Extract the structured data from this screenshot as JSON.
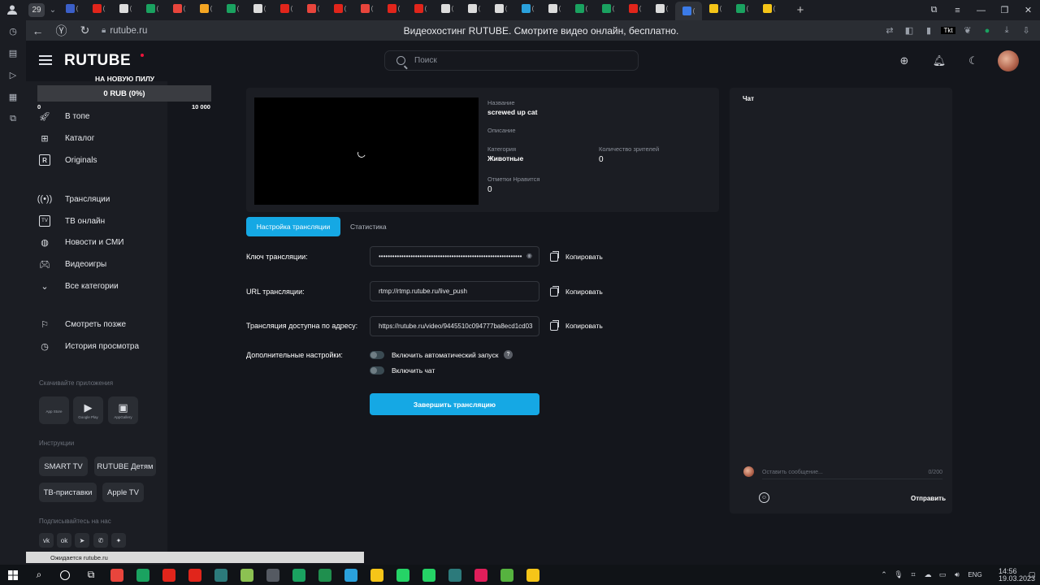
{
  "browser": {
    "tab_count": "29",
    "url": "rutube.ru",
    "page_title": "Видеохостинг RUTUBE. Смотрите видео онлайн, бесплатно.",
    "tabs": [
      {
        "color": "#3b5fc8"
      },
      {
        "color": "#e1251b"
      },
      {
        "color": "#dcdcdc"
      },
      {
        "color": "#1aa260"
      },
      {
        "color": "#e8453c"
      },
      {
        "color": "#f5a623"
      },
      {
        "color": "#1aa260"
      },
      {
        "color": "#dcdcdc"
      },
      {
        "color": "#e1251b"
      },
      {
        "color": "#e8453c"
      },
      {
        "color": "#e1251b"
      },
      {
        "color": "#e8453c"
      },
      {
        "color": "#e1251b"
      },
      {
        "color": "#e1251b"
      },
      {
        "color": "#dcdcdc"
      },
      {
        "color": "#dcdcdc"
      },
      {
        "color": "#dcdcdc"
      },
      {
        "color": "#2aa1dc"
      },
      {
        "color": "#dcdcdc"
      },
      {
        "color": "#1aa260"
      },
      {
        "color": "#1aa260"
      },
      {
        "color": "#e1251b"
      },
      {
        "color": "#dcdcdc"
      },
      {
        "color": "#3b7be8"
      },
      {
        "color": "#f5c518"
      },
      {
        "color": "#1aa260"
      },
      {
        "color": "#f5c518"
      }
    ],
    "status_text": "Ожидается rutube.ru"
  },
  "header": {
    "logo": "RUTUBE",
    "search_placeholder": "Поиск"
  },
  "donation": {
    "title": "НА НОВУЮ ПИЛУ",
    "progress_text": "0 RUB (0%)",
    "progress_fraction": 0,
    "min": "0",
    "max": "10 000"
  },
  "nav": {
    "main": [
      {
        "label": "В топе",
        "icon": "rocket-icon"
      },
      {
        "label": "Каталог",
        "icon": "grid-icon"
      },
      {
        "label": "Originals",
        "icon": "originals-icon"
      }
    ],
    "secondary": [
      {
        "label": "Трансляции",
        "icon": "broadcast-icon"
      },
      {
        "label": "ТВ онлайн",
        "icon": "tv-icon"
      },
      {
        "label": "Новости и СМИ",
        "icon": "globe-icon"
      },
      {
        "label": "Видеоигры",
        "icon": "gamepad-icon"
      },
      {
        "label": "Все категории",
        "icon": "chevron-down-icon"
      }
    ],
    "library": [
      {
        "label": "Смотреть позже",
        "icon": "bookmark-icon"
      },
      {
        "label": "История просмотра",
        "icon": "history-icon"
      }
    ]
  },
  "download": {
    "heading": "Скачивайте приложения",
    "apps": [
      {
        "label": "App Store",
        "icon": "apple-icon"
      },
      {
        "label": "Google Play",
        "icon": "google-play-icon"
      },
      {
        "label": "AppGallery",
        "icon": "appgallery-icon"
      }
    ]
  },
  "instructions": {
    "heading": "Инструкции",
    "chips": [
      "SMART TV",
      "RUTUBE Детям",
      "ТВ-приставки",
      "Apple TV"
    ]
  },
  "subscribe": {
    "heading": "Подписывайтесь на нас",
    "networks": [
      "vk-icon",
      "ok-icon",
      "telegram-icon",
      "viber-icon",
      "zen-icon"
    ]
  },
  "stream": {
    "name_label": "Название",
    "name_value": "screwed up cat",
    "description_label": "Описание",
    "category_label": "Категория",
    "category_value": "Животные",
    "viewers_label": "Количество зрителей",
    "viewers_value": "0",
    "likes_label": "Отметки Нравится",
    "likes_value": "0"
  },
  "tabs": {
    "settings": "Настройка трансляции",
    "stats": "Статистика"
  },
  "form": {
    "key_label": "Ключ трансляции:",
    "key_value": "•••••••••••••••••••••••••••••••••••••••••••••••••••••••••••••••",
    "url_label": "URL трансляции:",
    "url_value": "rtmp://rtmp.rutube.ru/live_push",
    "address_label": "Трансляция доступна по адресу:",
    "address_value": "https://rutube.ru/video/9445510c094777ba8ecd1cd03",
    "copy_label": "Копировать",
    "extra_label": "Дополнительные настройки:",
    "autostart_label": "Включить автоматический запуск",
    "help_mark": "?",
    "chat_toggle_label": "Включить чат",
    "end_button": "Завершить трансляцию"
  },
  "chat": {
    "title": "Чат",
    "input_placeholder": "Оставить сообщение...",
    "counter": "0/200",
    "send": "Отправить"
  },
  "taskbar": {
    "apps": [
      {
        "name": "yandex-browser-icon",
        "color": "#e8453c"
      },
      {
        "name": "chrome-icon",
        "color": "#1aa260"
      },
      {
        "name": "yandex-icon",
        "color": "#e1251b"
      },
      {
        "name": "opera-icon",
        "color": "#e1251b"
      },
      {
        "name": "pdx-icon",
        "color": "#2c7a7b"
      },
      {
        "name": "bluestacks-icon",
        "color": "#8cc152"
      },
      {
        "name": "obs-icon",
        "color": "#555a62"
      },
      {
        "name": "sheets-icon",
        "color": "#1aa260"
      },
      {
        "name": "excel-icon",
        "color": "#1f8f4e"
      },
      {
        "name": "notepad-icon",
        "color": "#2aa1dc"
      },
      {
        "name": "explorer-icon",
        "color": "#f5c518"
      },
      {
        "name": "whatsapp-icon",
        "color": "#25d366"
      },
      {
        "name": "whatsapp-2-icon",
        "color": "#25d366"
      },
      {
        "name": "pdx-2-icon",
        "color": "#2c7a7b"
      },
      {
        "name": "slack-icon",
        "color": "#e01e5a"
      },
      {
        "name": "utorrent-icon",
        "color": "#56b33f"
      },
      {
        "name": "game-icon",
        "color": "#f5c518"
      }
    ],
    "lang": "ENG",
    "time": "14:56",
    "date": "19.03.2023"
  }
}
